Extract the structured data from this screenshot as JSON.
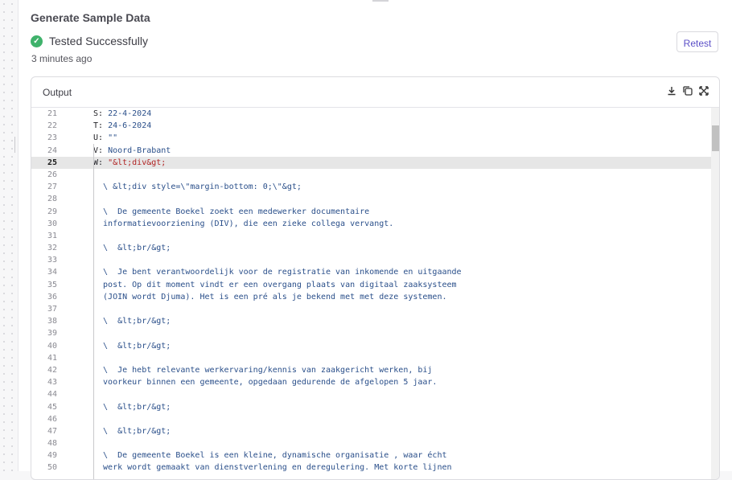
{
  "section": {
    "title": "Generate Sample Data",
    "status": "Tested Successfully",
    "time": "3 minutes ago",
    "retest_label": "Retest"
  },
  "output": {
    "title": "Output",
    "tools": [
      "download-icon",
      "copy-icon",
      "expand-icon"
    ],
    "lines": [
      {
        "n": "21",
        "key": "S: ",
        "val": "22-4-2024"
      },
      {
        "n": "22",
        "key": "T: ",
        "val": "24-6-2024"
      },
      {
        "n": "23",
        "key": "U: ",
        "val": "\"\""
      },
      {
        "n": "24",
        "key": "V: ",
        "val": "Noord-Brabant"
      },
      {
        "n": "25",
        "key": "W: ",
        "str": "\"&lt;div&gt;",
        "active": true
      },
      {
        "n": "26",
        "text": ""
      },
      {
        "n": "27",
        "text": "  \\ &lt;div style=\\\"margin-bottom: 0;\\\"&gt;"
      },
      {
        "n": "28",
        "text": ""
      },
      {
        "n": "29",
        "text": "  \\  De gemeente Boekel zoekt een medewerker documentaire"
      },
      {
        "n": "30",
        "text": "  informatievoorziening (DIV), die een zieke collega vervangt."
      },
      {
        "n": "31",
        "text": ""
      },
      {
        "n": "32",
        "text": "  \\  &lt;br/&gt;"
      },
      {
        "n": "33",
        "text": ""
      },
      {
        "n": "34",
        "text": "  \\  Je bent verantwoordelijk voor de registratie van inkomende en uitgaande"
      },
      {
        "n": "35",
        "text": "  post. Op dit moment vindt er een overgang plaats van digitaal zaaksysteem"
      },
      {
        "n": "36",
        "text": "  (JOIN wordt Djuma). Het is een pré als je bekend met met deze systemen."
      },
      {
        "n": "37",
        "text": ""
      },
      {
        "n": "38",
        "text": "  \\  &lt;br/&gt;"
      },
      {
        "n": "39",
        "text": ""
      },
      {
        "n": "40",
        "text": "  \\  &lt;br/&gt;"
      },
      {
        "n": "41",
        "text": ""
      },
      {
        "n": "42",
        "text": "  \\  Je hebt relevante werkervaring/kennis van zaakgericht werken, bij"
      },
      {
        "n": "43",
        "text": "  voorkeur binnen een gemeente, opgedaan gedurende de afgelopen 5 jaar."
      },
      {
        "n": "44",
        "text": ""
      },
      {
        "n": "45",
        "text": "  \\  &lt;br/&gt;"
      },
      {
        "n": "46",
        "text": ""
      },
      {
        "n": "47",
        "text": "  \\  &lt;br/&gt;"
      },
      {
        "n": "48",
        "text": ""
      },
      {
        "n": "49",
        "text": "  \\  De gemeente Boekel is een kleine, dynamische organisatie , waar écht"
      },
      {
        "n": "50",
        "text": "  werk wordt gemaakt van dienstverlening en deregulering. Met korte lijnen"
      }
    ]
  }
}
